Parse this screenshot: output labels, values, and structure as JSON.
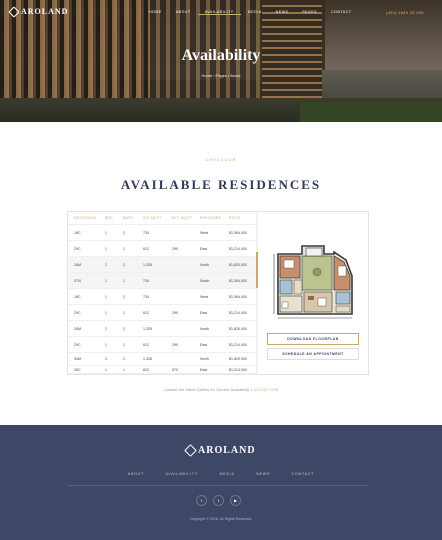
{
  "brand": {
    "name": "AROLAND"
  },
  "nav": {
    "items": [
      "HOME",
      "ABOUT",
      "AVAILABILITY",
      "MEDIA",
      "NEWS",
      "PAGES",
      "CONTACT"
    ],
    "active_index": 2
  },
  "header": {
    "phone": "(404) 1840 33 000"
  },
  "hero": {
    "title": "Availability",
    "breadcrumb": "Home / Pages / About"
  },
  "section": {
    "eyebrow": "CHECKOUR",
    "title": "AVAILABLE RESIDENCES"
  },
  "table": {
    "columns": [
      "RESIDENCE",
      "BED",
      "BATH",
      "INT SQ.FT",
      "EXT SQ.FT",
      "EXPOSURE",
      "PRICE"
    ],
    "rows": [
      [
        "19C",
        "1",
        "2",
        "734",
        "",
        "West",
        "$1,394,000"
      ],
      [
        "29C",
        "1",
        "1",
        "812",
        "290",
        "East",
        "$1,214,000"
      ],
      [
        "34M",
        "2",
        "2",
        "1,335",
        "",
        "North",
        "$1,820,000"
      ],
      [
        "07N",
        "1",
        "1",
        "734",
        "",
        "South",
        "$1,394,000"
      ],
      [
        "19C",
        "1",
        "2",
        "734",
        "",
        "West",
        "$1,394,000"
      ],
      [
        "29C",
        "1",
        "1",
        "812",
        "290",
        "East",
        "$1,214,000"
      ],
      [
        "34M",
        "2",
        "2",
        "1,335",
        "",
        "North",
        "$1,820,000"
      ],
      [
        "29C",
        "1",
        "1",
        "812",
        "290",
        "East",
        "$1,214,000"
      ],
      [
        "34M",
        "2",
        "2",
        "1,335",
        "",
        "North",
        "$1,820,000"
      ],
      [
        "29C",
        "1",
        "1",
        "812",
        "570",
        "East",
        "$1,214,000"
      ]
    ],
    "highlighted_rows": [
      2,
      3
    ]
  },
  "plan": {
    "download_label": "DOWNLOAD FLOORPLAN",
    "appointment_label": "SCHEDULE AN APPOINTMENT"
  },
  "contact": {
    "text": "Contact the Sales Gallery for Current Availability",
    "phone": "1.212.237.2725"
  },
  "footer": {
    "nav": [
      "ABOUT",
      "AVAILABILITY",
      "MEDIA",
      "NEWS",
      "CONTACT"
    ],
    "social_icons": [
      "facebook-icon",
      "twitter-icon",
      "youtube-icon"
    ],
    "copyright": "Copyright © 2018. All Rights Reserved."
  },
  "colors": {
    "accent": "#c9a86b",
    "navy": "#2f3a57",
    "footer_bg": "#3f4766"
  }
}
